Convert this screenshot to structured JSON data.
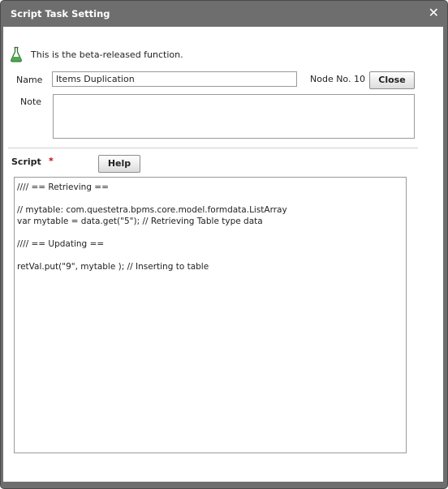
{
  "dialog": {
    "title": "Script Task Setting",
    "close_glyph": "✕"
  },
  "beta_notice": {
    "icon": "flask-icon",
    "text": "This is the beta-released function."
  },
  "form": {
    "name_label": "Name",
    "name_value": "Items Duplication",
    "node_no": "Node No. 10",
    "close_label": "Close",
    "note_label": "Note",
    "note_value": ""
  },
  "script": {
    "label": "Script",
    "required_mark": "*",
    "help_label": "Help",
    "lines": [
      "//// == Retrieving ==",
      "",
      "// mytable: com.questetra.bpms.core.model.formdata.ListArray",
      "var mytable = data.get(\"5\"); // Retrieving Table type data",
      "",
      "//// == Updating ==",
      "",
      "retVal.put(\"9\", mytable ); // Inserting to table"
    ]
  },
  "colors": {
    "titlebar": "#6e6e6e",
    "panel": "#ffffff",
    "required": "#cc0000",
    "flask": "#3a8a3a"
  }
}
